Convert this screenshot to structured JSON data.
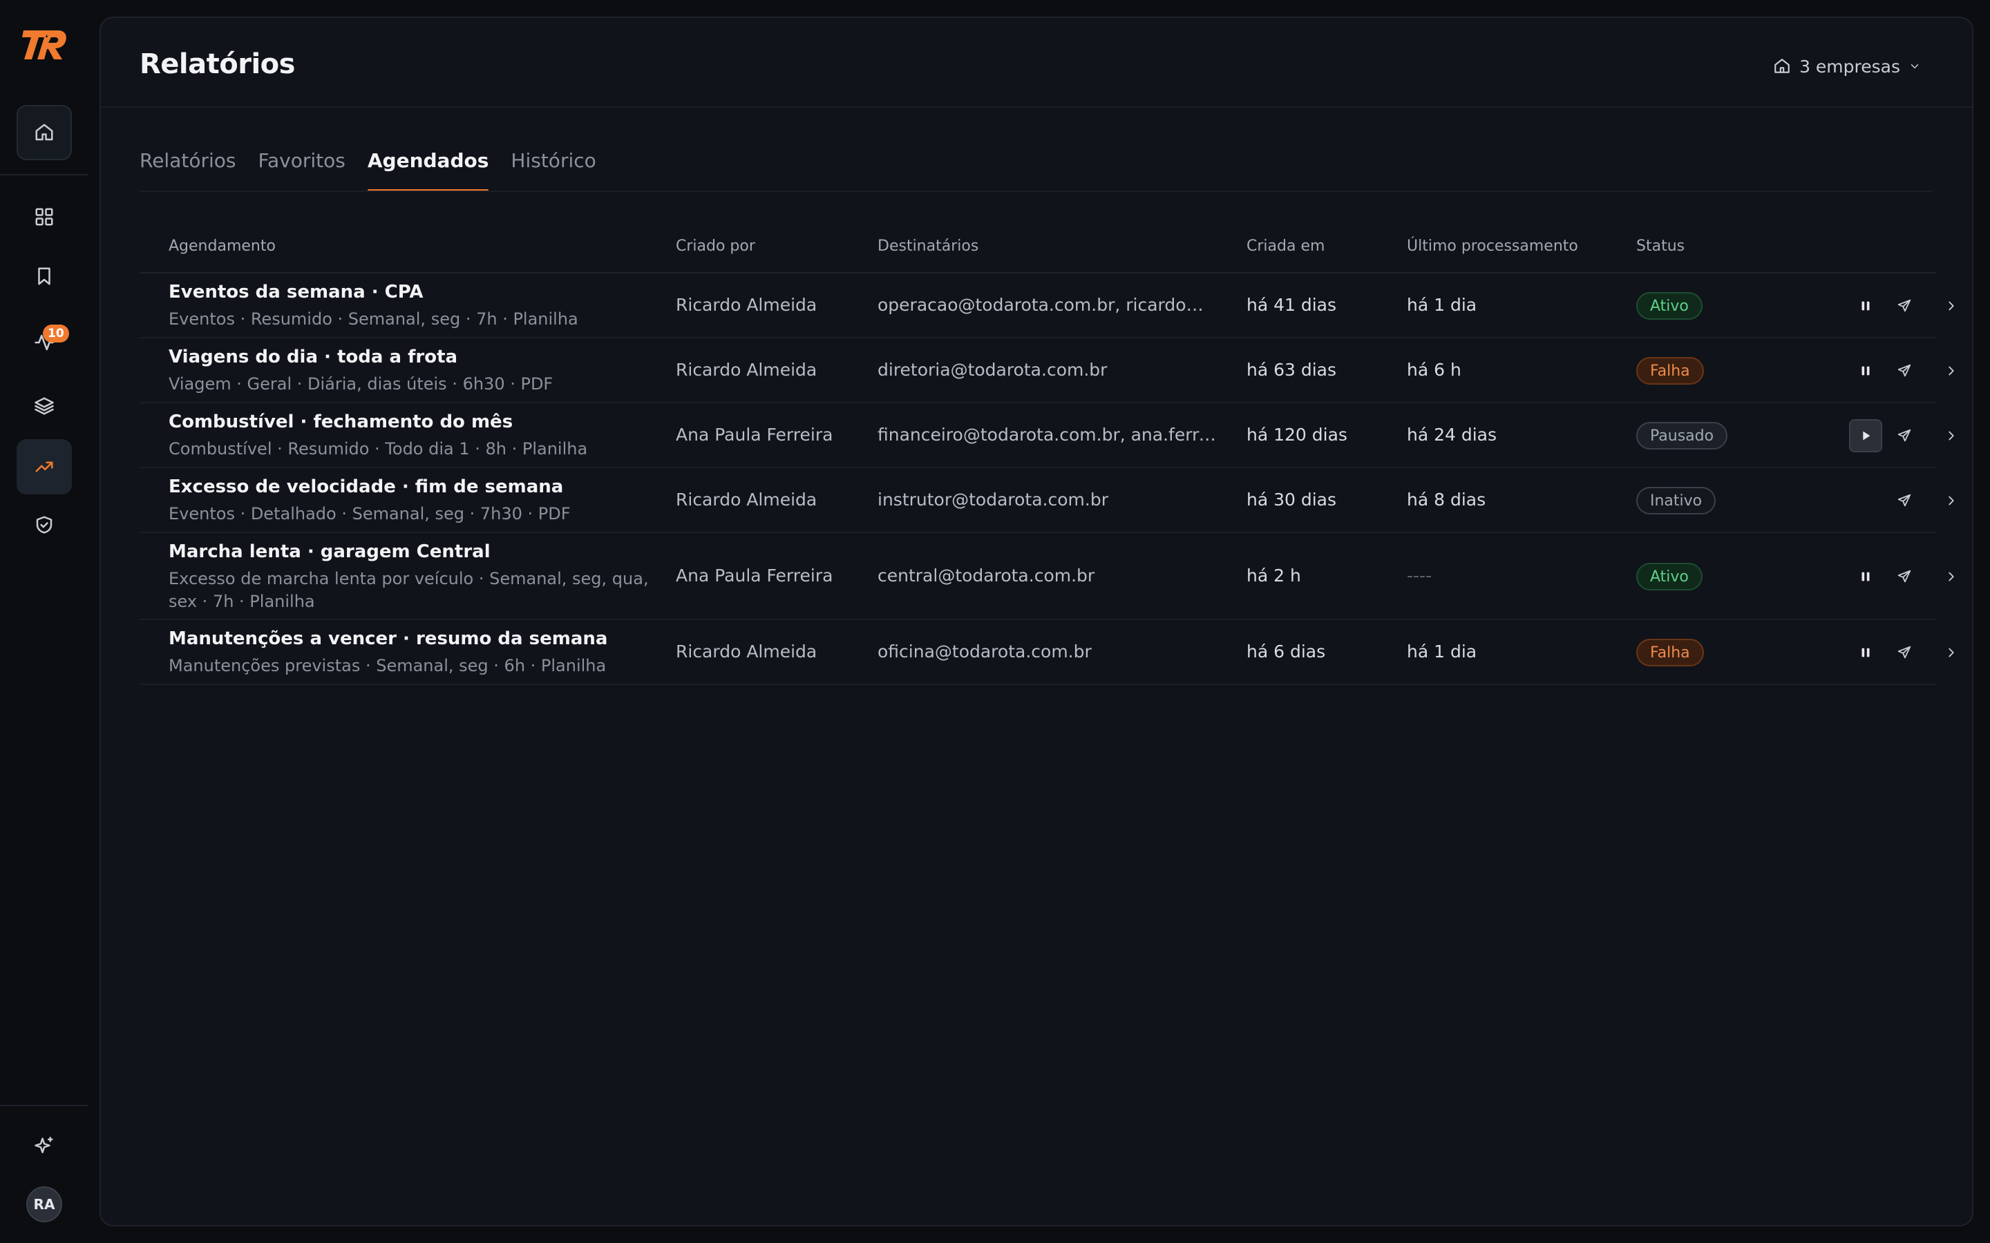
{
  "app": {
    "logo_text": "TR",
    "alert_badge": "10",
    "user_initials": "RA",
    "accent": "#f07a2e"
  },
  "header": {
    "title": "Relatórios",
    "companies_label": "3 empresas"
  },
  "tabs": [
    {
      "label": "Relatórios",
      "active": false
    },
    {
      "label": "Favoritos",
      "active": false
    },
    {
      "label": "Agendados",
      "active": true
    },
    {
      "label": "Histórico",
      "active": false
    }
  ],
  "table": {
    "columns": [
      "Agendamento",
      "Criado por",
      "Destinatários",
      "Criada em",
      "Último processamento",
      "Status"
    ],
    "rows": [
      {
        "title": "Eventos da semana · CPA",
        "subtitle": "Eventos · Resumido · Semanal, seg · 7h · Planilha",
        "creator": "Ricardo Almeida",
        "recipients": "operacao@todarota.com.br, ricardo@todarota.com.br",
        "created": "há 41 dias",
        "last": "há 1 dia",
        "status": "Ativo",
        "status_kind": "ativo",
        "control": "pause"
      },
      {
        "title": "Viagens do dia · toda a frota",
        "subtitle": "Viagem · Geral · Diária, dias úteis · 6h30 · PDF",
        "creator": "Ricardo Almeida",
        "recipients": "diretoria@todarota.com.br",
        "created": "há 63 dias",
        "last": "há 6 h",
        "status": "Falha",
        "status_kind": "falha",
        "control": "pause"
      },
      {
        "title": "Combustível · fechamento do mês",
        "subtitle": "Combustível · Resumido · Todo dia 1 · 8h · Planilha",
        "creator": "Ana Paula Ferreira",
        "recipients": "financeiro@todarota.com.br, ana.ferreira@todarota.com.br",
        "created": "há 120 dias",
        "last": "há 24 dias",
        "status": "Pausado",
        "status_kind": "pausado",
        "control": "play"
      },
      {
        "title": "Excesso de velocidade · fim de semana",
        "subtitle": "Eventos · Detalhado · Semanal, seg · 7h30 · PDF",
        "creator": "Ricardo Almeida",
        "recipients": "instrutor@todarota.com.br",
        "created": "há 30 dias",
        "last": "há 8 dias",
        "status": "Inativo",
        "status_kind": "inativo",
        "control": "none"
      },
      {
        "title": "Marcha lenta · garagem Central",
        "subtitle": "Excesso de marcha lenta por veículo · Semanal, seg, qua, sex · 7h · Planilha",
        "creator": "Ana Paula Ferreira",
        "recipients": "central@todarota.com.br",
        "created": "há 2 h",
        "last": "----",
        "status": "Ativo",
        "status_kind": "ativo",
        "control": "pause"
      },
      {
        "title": "Manutenções a vencer · resumo da semana",
        "subtitle": "Manutenções previstas · Semanal, seg · 6h · Planilha",
        "creator": "Ricardo Almeida",
        "recipients": "oficina@todarota.com.br",
        "created": "há 6 dias",
        "last": "há 1 dia",
        "status": "Falha",
        "status_kind": "falha",
        "control": "pause"
      }
    ]
  }
}
